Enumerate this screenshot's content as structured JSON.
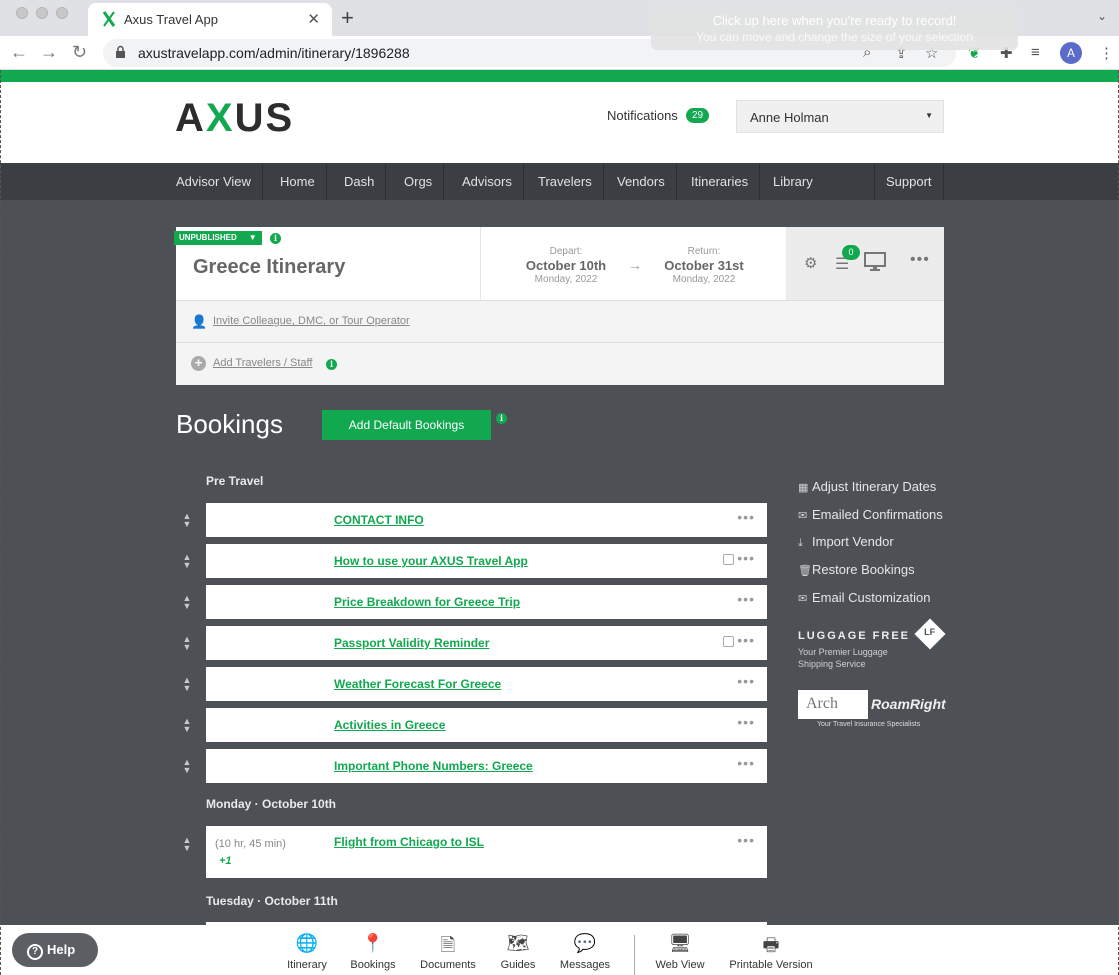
{
  "browser": {
    "tab_title": "Axus Travel App",
    "url": "axustravelapp.com/admin/itinerary/1896288",
    "profile_initial": "A",
    "recording_toast": {
      "line1": "Click up here when you're ready to record!",
      "line2": "You can move and change the size of your selection"
    }
  },
  "header": {
    "logo_left": "A",
    "logo_x": "X",
    "logo_right": "US",
    "notifications_label": "Notifications",
    "notifications_count": "29",
    "user_name": "Anne Holman"
  },
  "nav": {
    "items": [
      "Advisor View",
      "Home",
      "Dash",
      "Orgs",
      "Advisors",
      "Travelers",
      "Vendors",
      "Itineraries",
      "Library",
      "Support"
    ]
  },
  "itinerary": {
    "status": "UNPUBLISHED",
    "title": "Greece Itinerary",
    "depart_label": "Depart:",
    "depart_date": "October 10th",
    "depart_sub": "Monday, 2022",
    "return_label": "Return:",
    "return_date": "October 31st",
    "return_sub": "Monday, 2022",
    "checklist_count": "0",
    "invite_text": "Invite Colleague, DMC, or Tour Operator",
    "add_travelers_text": "Add Travelers / Staff"
  },
  "bookings": {
    "heading": "Bookings",
    "add_default_label": "Add Default Bookings",
    "sections": [
      {
        "title": "Pre Travel",
        "items": [
          {
            "title": "CONTACT INFO",
            "note": false
          },
          {
            "title": "How to use your AXUS Travel App",
            "note": true
          },
          {
            "title": "Price Breakdown for Greece Trip",
            "note": false
          },
          {
            "title": "Passport Validity Reminder",
            "note": true
          },
          {
            "title": "Weather Forecast For Greece",
            "note": false
          },
          {
            "title": "Activities in Greece",
            "note": false
          },
          {
            "title": "Important Phone Numbers: Greece",
            "note": false
          }
        ]
      },
      {
        "title": "Monday · October 10th",
        "items": [
          {
            "title": "Flight from Chicago to ISL",
            "duration": "(10 hr, 45 min)",
            "extra": "+1"
          }
        ]
      },
      {
        "title": "Tuesday · October 11th",
        "items": []
      }
    ]
  },
  "side_links": [
    "Adjust Itinerary Dates",
    "Emailed Confirmations",
    "Import Vendor",
    "Restore Bookings",
    "Email Customization"
  ],
  "partners": {
    "luggage_free_name": "LUGGAGE FREE",
    "luggage_free_badge": "LF",
    "luggage_free_tagline": "Your Premier Luggage Shipping Service",
    "arch_name": "Arch",
    "roamright_name": "RoamRight",
    "roamright_tagline": "Your Travel Insurance Specialists"
  },
  "bottom_nav": {
    "help_label": "Help",
    "items": [
      "Itinerary",
      "Bookings",
      "Documents",
      "Guides",
      "Messages",
      "Web View",
      "Printable Version"
    ]
  },
  "colors": {
    "accent": "#11a84f",
    "main_bg": "#4d5156",
    "nav_bg": "#3b3f43"
  }
}
